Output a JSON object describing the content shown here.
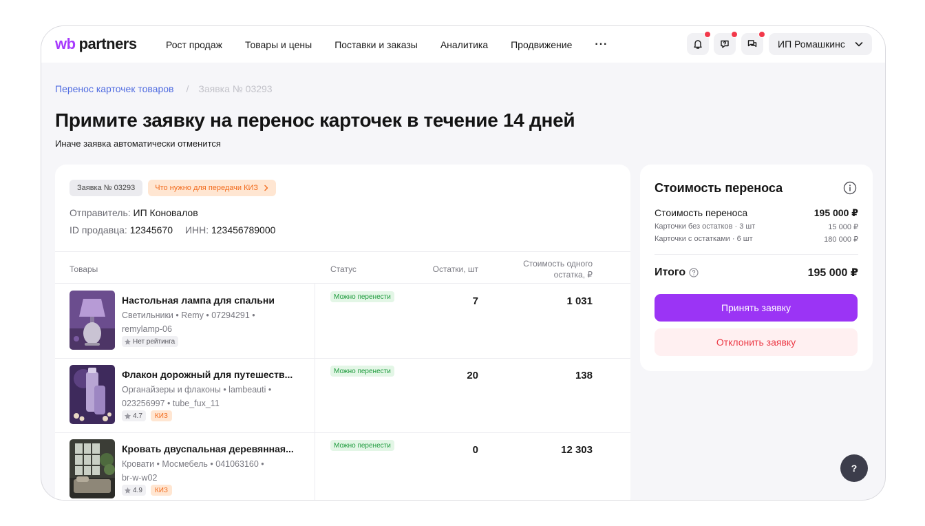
{
  "header": {
    "logo_wb": "wb",
    "logo_partners": "partners",
    "nav": [
      "Рост продаж",
      "Товары и цены",
      "Поставки и заказы",
      "Аналитика",
      "Продвижение"
    ],
    "more": "···",
    "user_name": "ИП Ромашкинс"
  },
  "breadcrumb": {
    "parent": "Перенос карточек товаров",
    "separator": "/",
    "current": "Заявка № 03293"
  },
  "page": {
    "title": "Примите заявку на перенос карточек в течение 14 дней",
    "subtitle": "Иначе заявка автоматически отменится"
  },
  "request": {
    "badge": "Заявка № 03293",
    "kiz_link": "Что нужно для передачи КИЗ",
    "sender_label": "Отправитель:",
    "sender_value": "ИП Коновалов",
    "seller_id_label": "ID продавца:",
    "seller_id_value": "12345670",
    "inn_label": "ИНН:",
    "inn_value": "123456789000"
  },
  "table": {
    "headers": {
      "products": "Товары",
      "status": "Статус",
      "stock": "Остатки, шт",
      "unit_cost_line1": "Стоимость одного",
      "unit_cost_line2": "остатка, ₽"
    },
    "rows": [
      {
        "name": "Настольная лампа для спальни",
        "desc_line1": "Светильники • Remy • 07294291 •",
        "desc_line2": "remylamp-06",
        "rating": "Нет рейтинга",
        "kiz": "",
        "status": "Можно перенести",
        "stock": "7",
        "price": "1 031"
      },
      {
        "name": "Флакон дорожный для путешеств...",
        "desc_line1": "Органайзеры и флаконы • lambeauti •",
        "desc_line2": "023256997 • tube_fux_11",
        "rating": "4.7",
        "kiz": "КИЗ",
        "status": "Можно перенести",
        "stock": "20",
        "price": "138"
      },
      {
        "name": "Кровать двуспальная деревянная...",
        "desc_line1": "Кровати • Мосмебель • 041063160 •",
        "desc_line2": "br-w-w02",
        "rating": "4.9",
        "kiz": "КИЗ",
        "status": "Можно перенести",
        "stock": "0",
        "price": "12 303"
      }
    ]
  },
  "summary": {
    "title": "Стоимость переноса",
    "cost_label": "Стоимость переноса",
    "cost_value": "195 000 ₽",
    "no_stock_label": "Карточки без остатков · 3 шт",
    "no_stock_value": "15 000 ₽",
    "with_stock_label": "Карточки с остатками · 6 шт",
    "with_stock_value": "180 000 ₽",
    "total_label": "Итого",
    "total_value": "195 000 ₽",
    "accept": "Принять заявку",
    "reject": "Отклонить заявку"
  },
  "help": "?",
  "colors": {
    "brand": "#a73afd",
    "accept": "#9b34f5",
    "reject_text": "#ec3b47",
    "link": "#4f6be0",
    "status_green": "#1d9a3c",
    "kiz_orange": "#f26b1d",
    "notify_dot": "#f2384a"
  }
}
